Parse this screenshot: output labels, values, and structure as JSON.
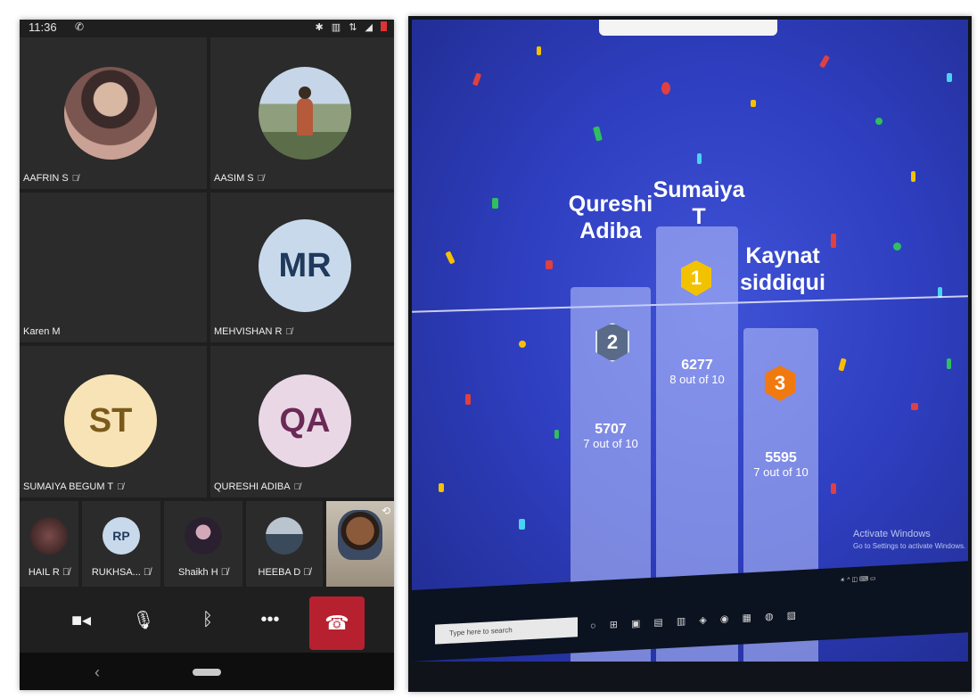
{
  "phone": {
    "status": {
      "time": "11:36"
    },
    "participants": [
      {
        "name": "AAFRIN S",
        "avatar_type": "photo"
      },
      {
        "name": "AASIM S",
        "avatar_type": "photo"
      },
      {
        "name": "Karen M",
        "avatar_type": "none"
      },
      {
        "name": "MEHVISHAN R",
        "initials": "MR",
        "avatar_color": "#c9d9ec",
        "initials_color": "#1f3a5a"
      },
      {
        "name": "SUMAIYA BEGUM T",
        "initials": "ST",
        "avatar_color": "#f7e3b5",
        "initials_color": "#7a5a1a"
      },
      {
        "name": "QURESHI ADIBA",
        "initials": "QA",
        "avatar_color": "#ead7e6",
        "initials_color": "#6a2a55"
      }
    ],
    "strip": [
      {
        "name": "HAIL R"
      },
      {
        "name": "RUKHSA...",
        "initials": "RP",
        "avatar_color": "#c9d9ec"
      },
      {
        "name": "Shaikh H"
      },
      {
        "name": "HEEBA D"
      }
    ],
    "controls": {
      "camera_icon": "camera-icon",
      "mic_icon": "mic-icon",
      "bluetooth_icon": "bluetooth-icon",
      "more_icon": "more-icon",
      "end_call_icon": "end-call-icon",
      "end_call_color": "#b7202f"
    }
  },
  "leaderboard": {
    "podium": [
      {
        "rank": "2",
        "name_line1": "Qureshi",
        "name_line2": "Adiba",
        "points": "5707",
        "correct": "7 out of 10",
        "badge_color": "#5a6b8a"
      },
      {
        "rank": "1",
        "name_line1": "Sumaiya T",
        "name_line2": "",
        "points": "6277",
        "correct": "8 out of 10",
        "badge_color": "#f2c200"
      },
      {
        "rank": "3",
        "name_line1": "Kaynat",
        "name_line2": "siddiqui",
        "points": "5595",
        "correct": "7 out of 10",
        "badge_color": "#f07a10"
      }
    ],
    "watermark_title": "Activate Windows",
    "watermark_sub": "Go to Settings to activate Windows.",
    "taskbar_search": "Type here to search"
  }
}
